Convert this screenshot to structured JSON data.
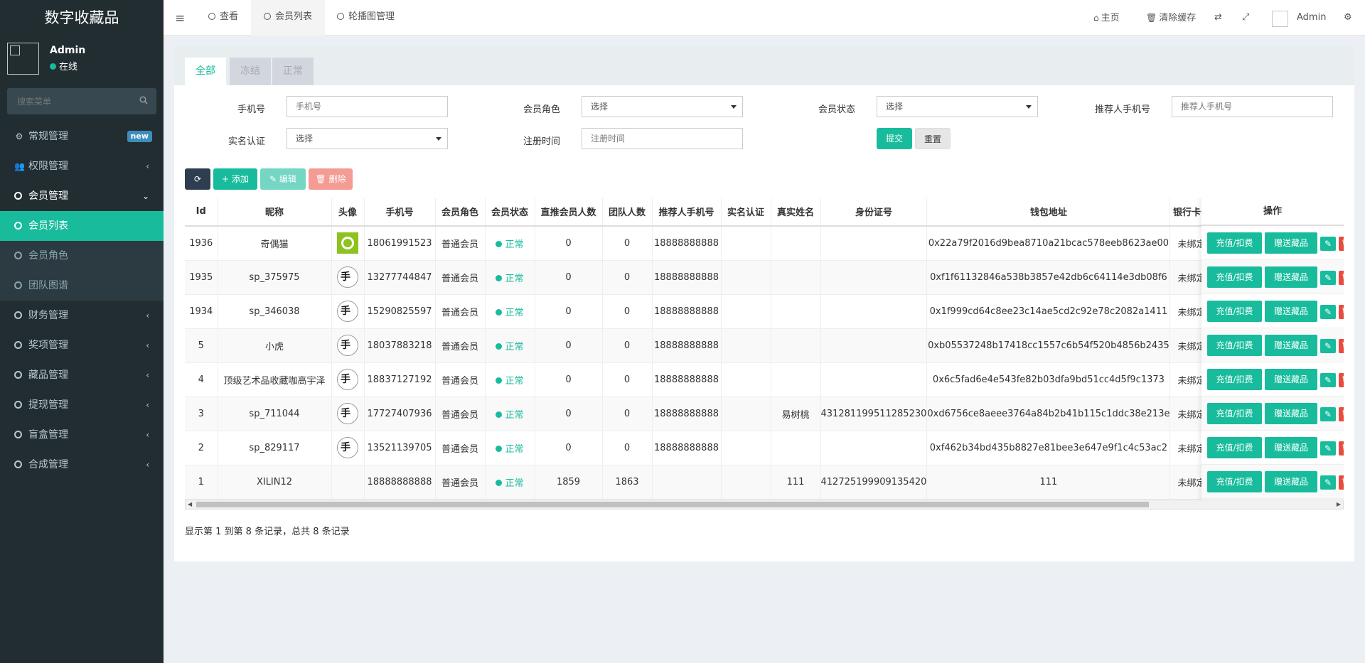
{
  "sidebar": {
    "logo": "数字收藏品",
    "user": {
      "name": "Admin",
      "status": "在线"
    },
    "search_placeholder": "搜索菜单",
    "menu": [
      {
        "label": "常规管理",
        "badge": "new"
      },
      {
        "label": "权限管理"
      },
      {
        "label": "会员管理"
      },
      {
        "label": "会员列表"
      },
      {
        "label": "会员角色"
      },
      {
        "label": "团队图谱"
      },
      {
        "label": "财务管理"
      },
      {
        "label": "奖项管理"
      },
      {
        "label": "藏品管理"
      },
      {
        "label": "提现管理"
      },
      {
        "label": "盲盒管理"
      },
      {
        "label": "合成管理"
      }
    ]
  },
  "header": {
    "tabs": [
      {
        "label": "查看"
      },
      {
        "label": "会员列表"
      },
      {
        "label": "轮播图管理"
      }
    ],
    "home": "主页",
    "clear_cache": "清除缓存",
    "user": "Admin"
  },
  "filter_tabs": [
    "全部",
    "冻结",
    "正常"
  ],
  "form": {
    "phone_label": "手机号",
    "phone_placeholder": "手机号",
    "role_label": "会员角色",
    "role_value": "选择",
    "status_label": "会员状态",
    "status_value": "选择",
    "ref_label": "推荐人手机号",
    "ref_placeholder": "推荐人手机号",
    "auth_label": "实名认证",
    "auth_value": "选择",
    "reg_label": "注册时间",
    "reg_placeholder": "注册时间",
    "submit": "提交",
    "reset": "重置"
  },
  "toolbar": {
    "add": "添加",
    "edit": "编辑",
    "delete": "删除"
  },
  "table": {
    "headers": [
      "Id",
      "昵称",
      "头像",
      "手机号",
      "会员角色",
      "会员状态",
      "直推会员人数",
      "团队人数",
      "推荐人手机号",
      "实名认证",
      "真实姓名",
      "身份证号",
      "钱包地址",
      "银行卡号"
    ],
    "ops_header": "操作",
    "ops_labels": {
      "recharge": "充值/扣费",
      "gift": "赠送藏品"
    },
    "rows": [
      {
        "id": "1936",
        "nick": "奇偶猫",
        "avatar": "green",
        "phone": "18061991523",
        "role": "普通会员",
        "status": "正常",
        "direct": "0",
        "team": "0",
        "ref": "18888888888",
        "auth": "",
        "realname": "",
        "idno": "",
        "wallet": "0x22a79f2016d9bea8710a21bcac578eeb8623ae00",
        "bank": "未绑定"
      },
      {
        "id": "1935",
        "nick": "sp_375975",
        "avatar": "logo",
        "phone": "13277744847",
        "role": "普通会员",
        "status": "正常",
        "direct": "0",
        "team": "0",
        "ref": "18888888888",
        "auth": "",
        "realname": "",
        "idno": "",
        "wallet": "0xf1f61132846a538b3857e42db6c64114e3db08f6",
        "bank": "未绑定"
      },
      {
        "id": "1934",
        "nick": "sp_346038",
        "avatar": "logo",
        "phone": "15290825597",
        "role": "普通会员",
        "status": "正常",
        "direct": "0",
        "team": "0",
        "ref": "18888888888",
        "auth": "",
        "realname": "",
        "idno": "",
        "wallet": "0x1f999cd64c8ee23c14ae5cd2c92e78c2082a1411",
        "bank": "未绑定"
      },
      {
        "id": "5",
        "nick": "小虎",
        "avatar": "logo",
        "phone": "18037883218",
        "role": "普通会员",
        "status": "正常",
        "direct": "0",
        "team": "0",
        "ref": "18888888888",
        "auth": "",
        "realname": "",
        "idno": "",
        "wallet": "0xb05537248b17418cc1557c6b54f520b4856b2435",
        "bank": "未绑定"
      },
      {
        "id": "4",
        "nick": "顶级艺术品收藏咖高宇泽",
        "avatar": "logo",
        "phone": "18837127192",
        "role": "普通会员",
        "status": "正常",
        "direct": "0",
        "team": "0",
        "ref": "18888888888",
        "auth": "",
        "realname": "",
        "idno": "",
        "wallet": "0x6c5fad6e4e543fe82b03dfa9bd51cc4d5f9c1373",
        "bank": "未绑定"
      },
      {
        "id": "3",
        "nick": "sp_711044",
        "avatar": "logo",
        "phone": "17727407936",
        "role": "普通会员",
        "status": "正常",
        "direct": "0",
        "team": "0",
        "ref": "18888888888",
        "auth": "",
        "realname": "易树桃",
        "idno": "431281199511285230",
        "wallet": "0xd6756ce8aeee3764a84b2b41b115c1ddc38e213e",
        "bank": "未绑定"
      },
      {
        "id": "2",
        "nick": "sp_829117",
        "avatar": "logo",
        "phone": "13521139705",
        "role": "普通会员",
        "status": "正常",
        "direct": "0",
        "team": "0",
        "ref": "18888888888",
        "auth": "",
        "realname": "",
        "idno": "",
        "wallet": "0xf462b34bd435b8827e81bee3e647e9f1c4c53ac2",
        "bank": "未绑定"
      },
      {
        "id": "1",
        "nick": "XILIN12",
        "avatar": "",
        "phone": "18888888888",
        "role": "普通会员",
        "status": "正常",
        "direct": "1859",
        "team": "1863",
        "ref": "",
        "auth": "",
        "realname": "111",
        "idno": "412725199909135420",
        "wallet": "111",
        "bank": "未绑定"
      }
    ]
  },
  "pager": "显示第 1 到第 8 条记录，总共 8 条记录",
  "colors": {
    "accent": "#18bc9c",
    "sidebar": "#222d32",
    "danger": "#e74c3c"
  }
}
